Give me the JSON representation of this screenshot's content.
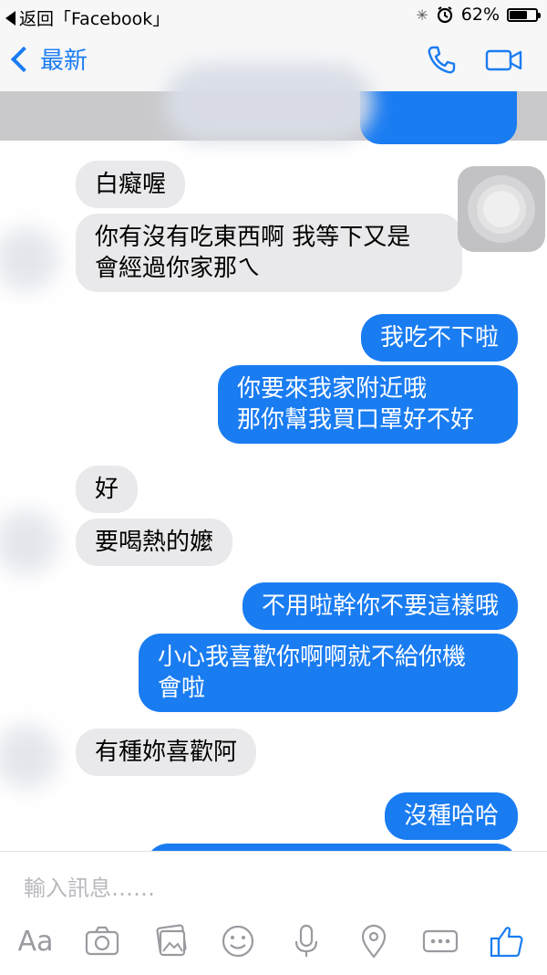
{
  "status_bar": {
    "back_app": "返回「Facebook」",
    "battery": "62%",
    "battery_level": 0.62
  },
  "nav": {
    "back_label": "最新"
  },
  "messages": [
    {
      "dir": "in",
      "text": "白癡喔"
    },
    {
      "dir": "in",
      "text": "你有沒有吃東西啊 我等下又是\n會經過你家那ㄟ"
    },
    {
      "dir": "out",
      "text": "我吃不下啦"
    },
    {
      "dir": "out",
      "text": "你要來我家附近哦\n那你幫我買口罩好不好"
    },
    {
      "dir": "in",
      "text": "好"
    },
    {
      "dir": "in",
      "text": "要喝熱的嬤"
    },
    {
      "dir": "out",
      "text": "不用啦幹你不要這樣哦"
    },
    {
      "dir": "out",
      "text": "小心我喜歡你啊啊就不給你機\n會啦"
    },
    {
      "dir": "in",
      "text": "有種妳喜歡阿"
    },
    {
      "dir": "out",
      "text": "沒種哈哈"
    }
  ],
  "composer": {
    "placeholder": "輸入訊息……",
    "toolbar": {
      "text_label": "Aa",
      "icons": [
        "camera-icon",
        "photo-icon",
        "emoji-icon",
        "microphone-icon",
        "location-icon",
        "more-icon",
        "like-icon"
      ]
    }
  },
  "colors": {
    "accent": "#1a7cf1",
    "incoming_bubble": "#e9e9eb",
    "bar_bg": "#f7f7f8"
  }
}
